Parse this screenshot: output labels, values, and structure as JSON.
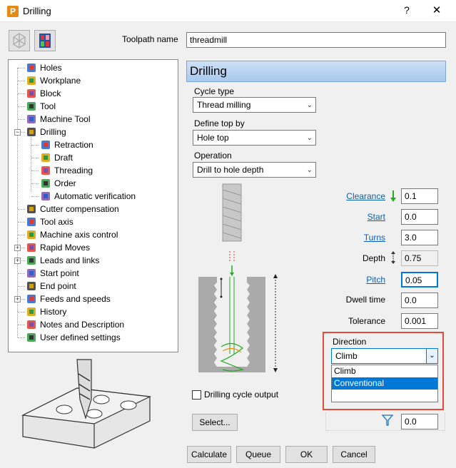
{
  "window": {
    "title": "Drilling",
    "app_icon": "P",
    "help": "?",
    "close": "✕"
  },
  "toolpath_name": {
    "label": "Toolpath name",
    "value": "threadmill"
  },
  "tree": {
    "items": [
      {
        "label": "Holes",
        "icon": "holes-icon"
      },
      {
        "label": "Workplane",
        "icon": "workplane-icon"
      },
      {
        "label": "Block",
        "icon": "block-icon"
      },
      {
        "label": "Tool",
        "icon": "tool-icon"
      },
      {
        "label": "Machine Tool",
        "icon": "machine-tool-icon"
      },
      {
        "label": "Drilling",
        "icon": "drilling-icon"
      },
      {
        "label": "Retraction",
        "icon": "retraction-icon"
      },
      {
        "label": "Draft",
        "icon": "draft-icon"
      },
      {
        "label": "Threading",
        "icon": "threading-icon"
      },
      {
        "label": "Order",
        "icon": "order-icon"
      },
      {
        "label": "Automatic verification",
        "icon": "verification-icon"
      },
      {
        "label": "Cutter compensation",
        "icon": "cutter-compensation-icon"
      },
      {
        "label": "Tool axis",
        "icon": "tool-axis-icon"
      },
      {
        "label": "Machine axis control",
        "icon": "machine-axis-icon"
      },
      {
        "label": "Rapid Moves",
        "icon": "rapid-moves-icon"
      },
      {
        "label": "Leads and links",
        "icon": "leads-links-icon"
      },
      {
        "label": "Start point",
        "icon": "start-point-icon"
      },
      {
        "label": "End point",
        "icon": "end-point-icon"
      },
      {
        "label": "Feeds and speeds",
        "icon": "feeds-speeds-icon"
      },
      {
        "label": "History",
        "icon": "history-icon"
      },
      {
        "label": "Notes and Description",
        "icon": "notes-icon"
      },
      {
        "label": "User defined settings",
        "icon": "user-settings-icon"
      }
    ]
  },
  "panel": {
    "title": "Drilling",
    "cycle_type": {
      "label": "Cycle type",
      "value": "Thread milling"
    },
    "define_top": {
      "label": "Define top by",
      "value": "Hole top"
    },
    "operation": {
      "label": "Operation",
      "value": "Drill to hole depth"
    },
    "params": {
      "clearance": {
        "label": "Clearance",
        "value": "0.1"
      },
      "start": {
        "label": "Start",
        "value": "0.0"
      },
      "turns": {
        "label": "Turns",
        "value": "3.0"
      },
      "depth": {
        "label": "Depth",
        "value": "0.75"
      },
      "pitch": {
        "label": "Pitch",
        "value": "0.05"
      },
      "dwell": {
        "label": "Dwell time",
        "value": "0.0"
      },
      "tolerance": {
        "label": "Tolerance",
        "value": "0.001"
      }
    },
    "direction": {
      "label": "Direction",
      "value": "Climb",
      "options": [
        "Climb",
        "Conventional"
      ],
      "highlighted": "Conventional"
    },
    "drilling_cycle_output": {
      "label": "Drilling cycle output",
      "checked": false
    },
    "select_button": "Select...",
    "filter_value": "0.0"
  },
  "buttons": {
    "calculate": "Calculate",
    "queue": "Queue",
    "ok": "OK",
    "cancel": "Cancel"
  },
  "colors": {
    "accent": "#0078d7",
    "highlight_border": "#e54b3c",
    "link": "#0b5fb3"
  }
}
